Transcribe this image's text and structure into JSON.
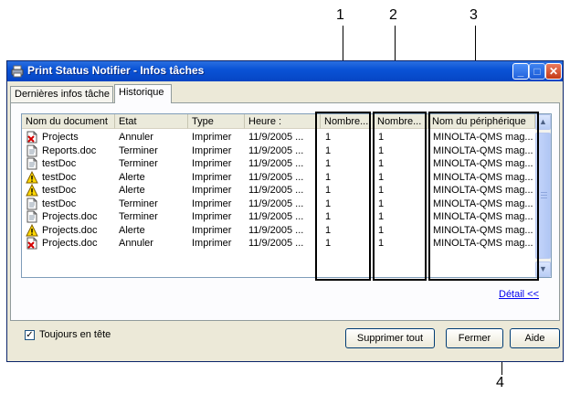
{
  "callouts": [
    "1",
    "2",
    "3",
    "4"
  ],
  "window": {
    "title": "Print Status Notifier - Infos tâches",
    "minimize": "_",
    "maximize": "□",
    "close": "✕"
  },
  "tabs": [
    {
      "label": "Dernières infos tâche",
      "selected": false
    },
    {
      "label": "Historique",
      "selected": true
    }
  ],
  "table": {
    "columns": [
      "Nom du document",
      "Etat",
      "Type",
      "Heure :",
      "Nombre...",
      "Nombre...",
      "Nom du périphérique"
    ],
    "rows": [
      {
        "icon": "error-doc-icon",
        "name": "Projects",
        "etat": "Annuler",
        "type": "Imprimer",
        "heure": "11/9/2005 ...",
        "n1": "1",
        "n2": "1",
        "device": "MINOLTA-QMS mag..."
      },
      {
        "icon": "document-icon",
        "name": "Reports.doc",
        "etat": "Terminer",
        "type": "Imprimer",
        "heure": "11/9/2005 ...",
        "n1": "1",
        "n2": "1",
        "device": "MINOLTA-QMS mag..."
      },
      {
        "icon": "document-icon",
        "name": "testDoc",
        "etat": "Terminer",
        "type": "Imprimer",
        "heure": "11/9/2005 ...",
        "n1": "1",
        "n2": "1",
        "device": "MINOLTA-QMS mag..."
      },
      {
        "icon": "warning-icon",
        "name": "testDoc",
        "etat": "Alerte",
        "type": "Imprimer",
        "heure": "11/9/2005 ...",
        "n1": "1",
        "n2": "1",
        "device": "MINOLTA-QMS mag..."
      },
      {
        "icon": "warning-icon",
        "name": "testDoc",
        "etat": "Alerte",
        "type": "Imprimer",
        "heure": "11/9/2005 ...",
        "n1": "1",
        "n2": "1",
        "device": "MINOLTA-QMS mag..."
      },
      {
        "icon": "document-icon",
        "name": "testDoc",
        "etat": "Terminer",
        "type": "Imprimer",
        "heure": "11/9/2005 ...",
        "n1": "1",
        "n2": "1",
        "device": "MINOLTA-QMS mag..."
      },
      {
        "icon": "document-icon",
        "name": "Projects.doc",
        "etat": "Terminer",
        "type": "Imprimer",
        "heure": "11/9/2005 ...",
        "n1": "1",
        "n2": "1",
        "device": "MINOLTA-QMS mag..."
      },
      {
        "icon": "warning-icon",
        "name": "Projects.doc",
        "etat": "Alerte",
        "type": "Imprimer",
        "heure": "11/9/2005 ...",
        "n1": "1",
        "n2": "1",
        "device": "MINOLTA-QMS mag..."
      },
      {
        "icon": "error-doc-icon",
        "name": "Projects.doc",
        "etat": "Annuler",
        "type": "Imprimer",
        "heure": "11/9/2005 ...",
        "n1": "1",
        "n2": "1",
        "device": "MINOLTA-QMS mag..."
      }
    ]
  },
  "detail_link": "Détail <<",
  "always_on_top": {
    "label": "Toujours en tête",
    "checked": true,
    "mark": "✓"
  },
  "buttons": {
    "delete_all": "Supprimer tout",
    "close": "Fermer",
    "help": "Aide"
  },
  "scroll": {
    "up": "▲",
    "down": "▼"
  }
}
